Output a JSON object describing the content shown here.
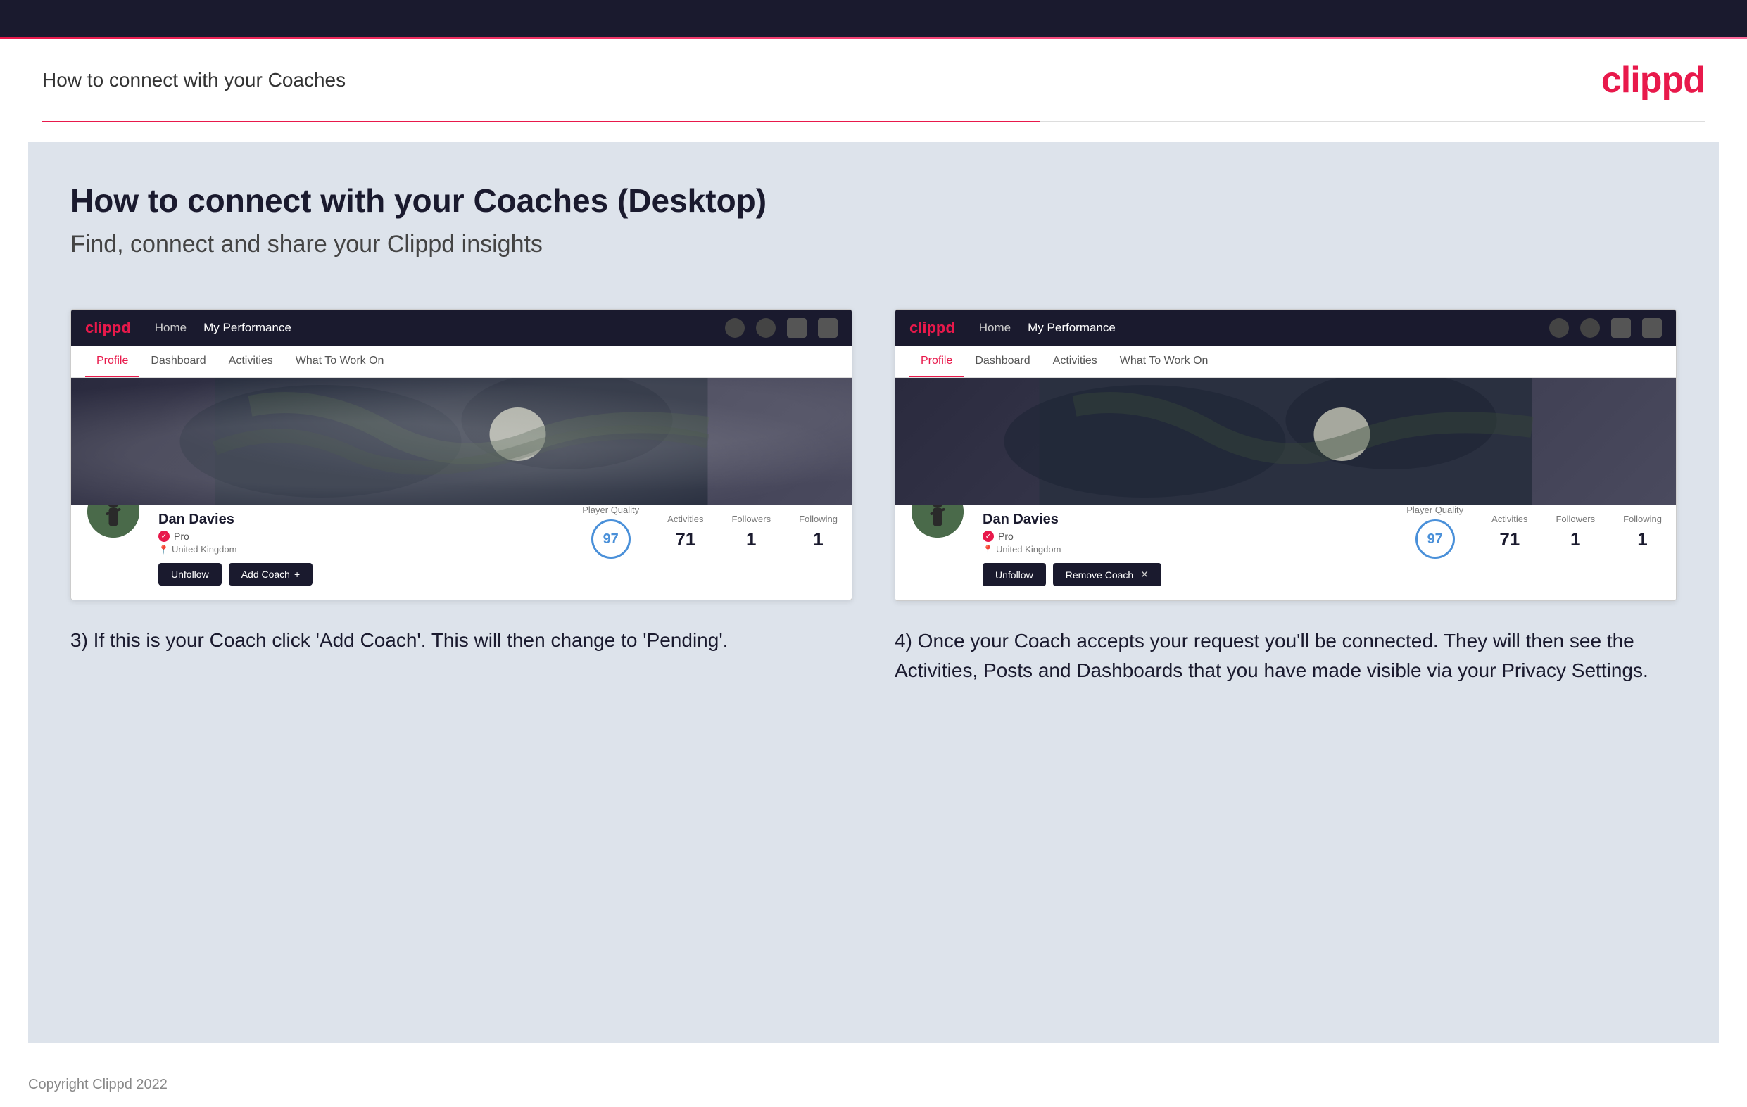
{
  "topBar": {
    "background": "#1a1a2e"
  },
  "header": {
    "title": "How to connect with your Coaches",
    "logo": "clippd"
  },
  "main": {
    "heading": "How to connect with your Coaches (Desktop)",
    "subheading": "Find, connect and share your Clippd insights",
    "screenshot1": {
      "navbar": {
        "logo": "clippd",
        "home": "Home",
        "myPerformance": "My Performance"
      },
      "tabs": [
        "Profile",
        "Dashboard",
        "Activities",
        "What To Work On"
      ],
      "activeTab": "Profile",
      "user": {
        "name": "Dan Davies",
        "role": "Pro",
        "location": "United Kingdom"
      },
      "stats": {
        "playerQuality": {
          "label": "Player Quality",
          "value": "97"
        },
        "activities": {
          "label": "Activities",
          "value": "71"
        },
        "followers": {
          "label": "Followers",
          "value": "1"
        },
        "following": {
          "label": "Following",
          "value": "1"
        }
      },
      "buttons": {
        "unfollow": "Unfollow",
        "addCoach": "Add Coach"
      }
    },
    "screenshot2": {
      "navbar": {
        "logo": "clippd",
        "home": "Home",
        "myPerformance": "My Performance"
      },
      "tabs": [
        "Profile",
        "Dashboard",
        "Activities",
        "What To Work On"
      ],
      "activeTab": "Profile",
      "user": {
        "name": "Dan Davies",
        "role": "Pro",
        "location": "United Kingdom"
      },
      "stats": {
        "playerQuality": {
          "label": "Player Quality",
          "value": "97"
        },
        "activities": {
          "label": "Activities",
          "value": "71"
        },
        "followers": {
          "label": "Followers",
          "value": "1"
        },
        "following": {
          "label": "Following",
          "value": "1"
        }
      },
      "buttons": {
        "unfollow": "Unfollow",
        "removeCoach": "Remove Coach"
      }
    },
    "caption1": "3) If this is your Coach click 'Add Coach'. This will then change to 'Pending'.",
    "caption2": "4) Once your Coach accepts your request you'll be connected. They will then see the Activities, Posts and Dashboards that you have made visible via your Privacy Settings."
  },
  "footer": {
    "copyright": "Copyright Clippd 2022"
  }
}
